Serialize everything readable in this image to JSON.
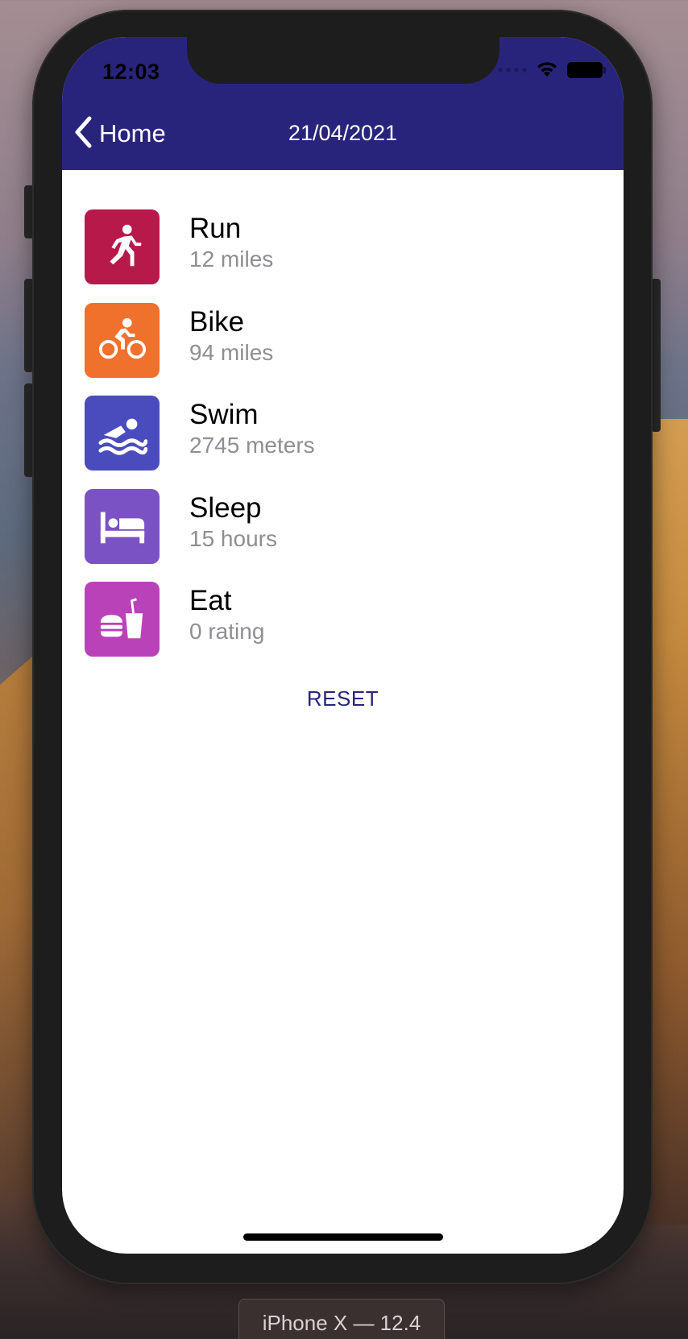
{
  "status_bar": {
    "time": "12:03"
  },
  "nav": {
    "back_label": "Home",
    "title": "21/04/2021"
  },
  "activities": [
    {
      "name": "Run",
      "value": "12 miles",
      "icon": "running-person-icon",
      "color": "#b8194b"
    },
    {
      "name": "Bike",
      "value": "94 miles",
      "icon": "cyclist-icon",
      "color": "#f0712c"
    },
    {
      "name": "Swim",
      "value": "2745 meters",
      "icon": "swimmer-icon",
      "color": "#4a4cbe"
    },
    {
      "name": "Sleep",
      "value": "15 hours",
      "icon": "bed-icon",
      "color": "#7b52c4"
    },
    {
      "name": "Eat",
      "value": "0 rating",
      "icon": "fast-food-icon",
      "color": "#b942b9"
    }
  ],
  "reset_label": "RESET",
  "simulator_label": "iPhone X — 12.4",
  "colors": {
    "nav_bar": "#29247b",
    "secondary_text": "#8e8e93",
    "accent": "#29247b"
  }
}
